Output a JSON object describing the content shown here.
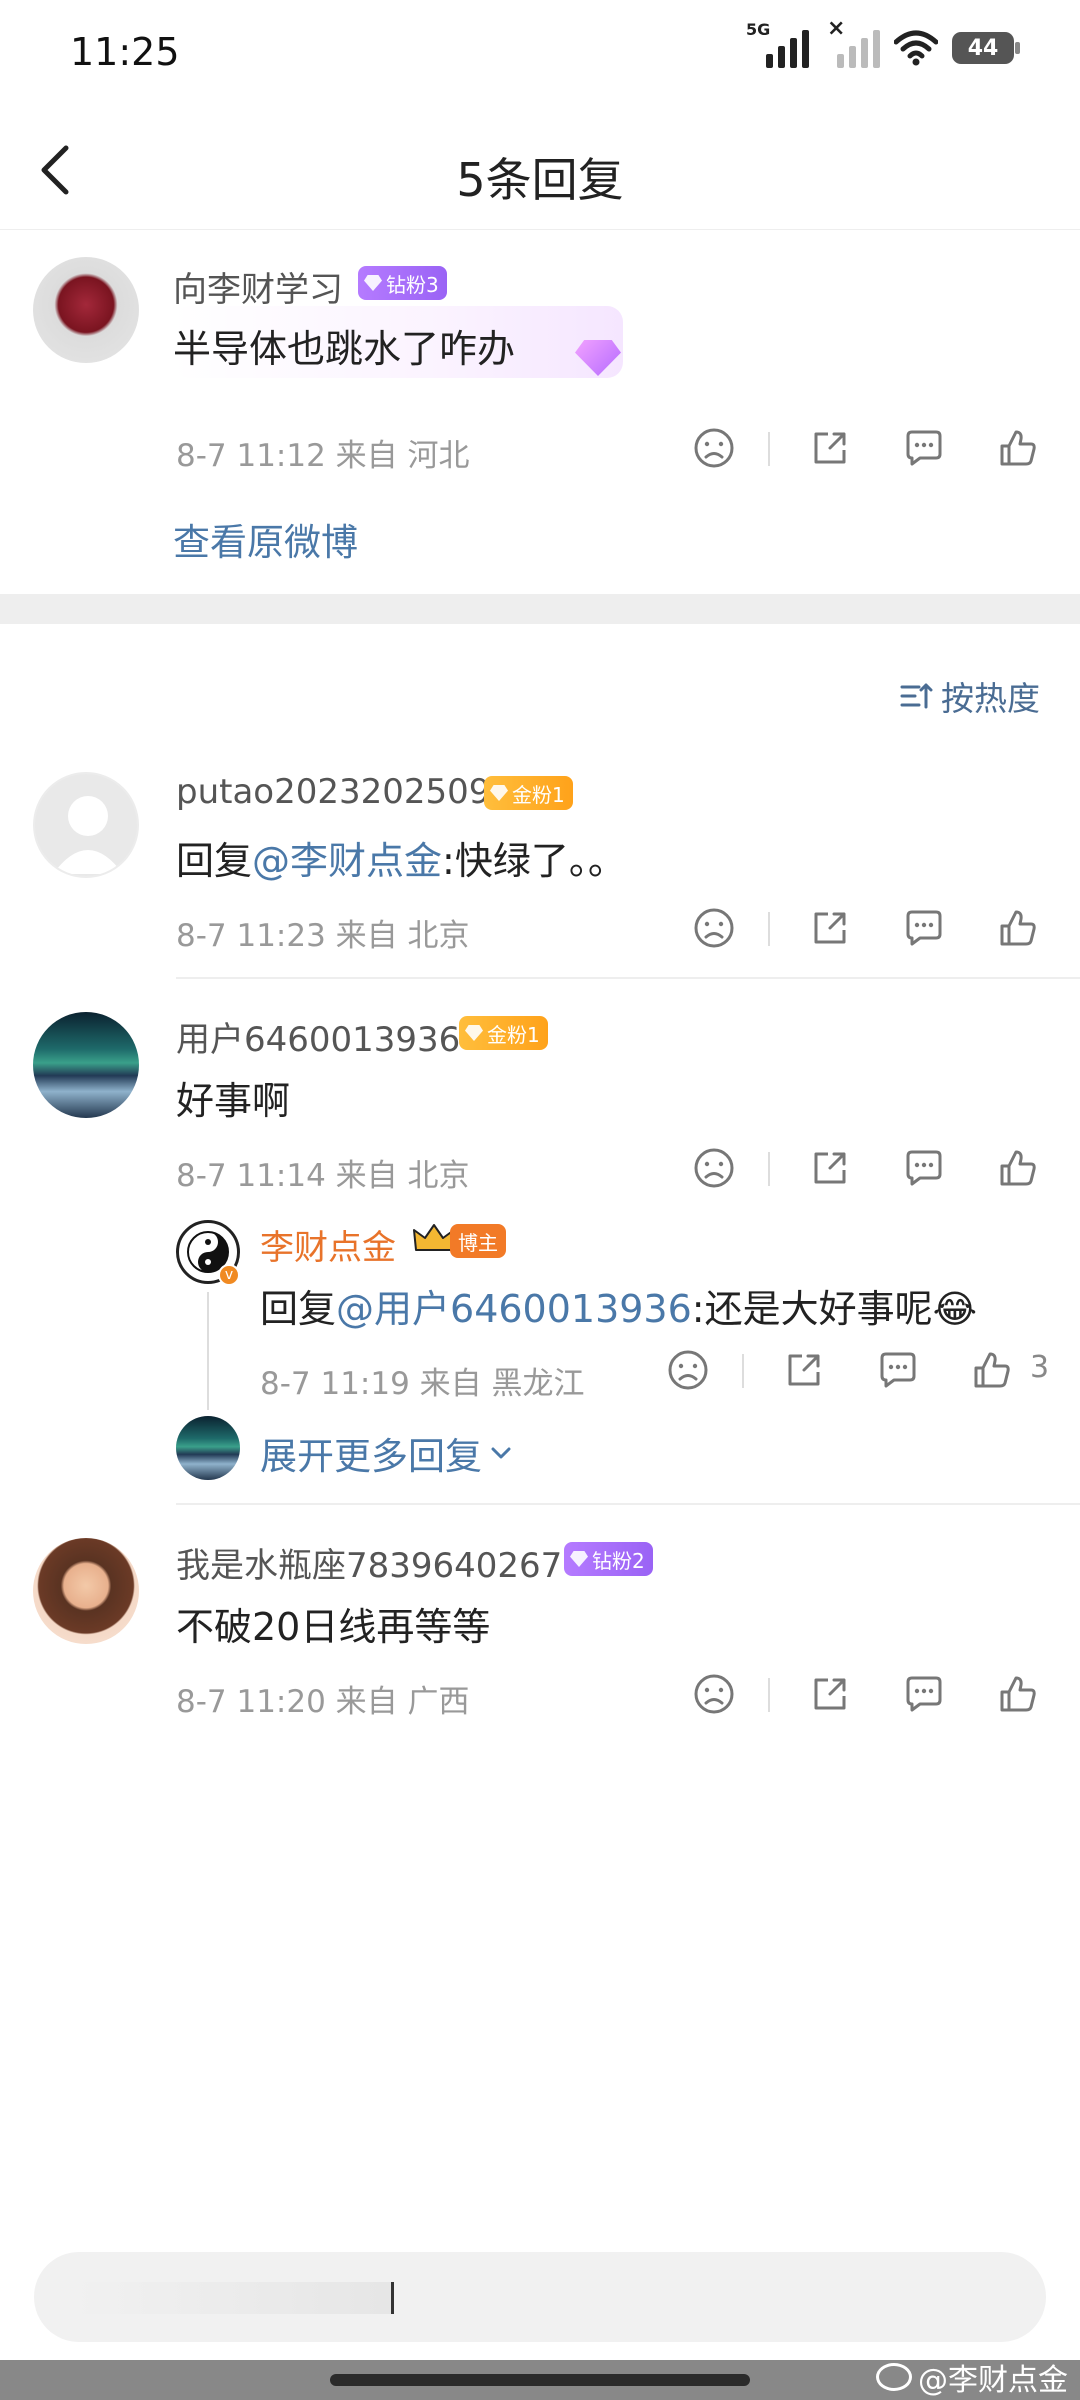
{
  "status": {
    "time": "11:25",
    "network": "5G",
    "battery": "44"
  },
  "nav": {
    "title": "5条回复"
  },
  "original": {
    "username": "向李财学习",
    "badge": "钻粉3",
    "content": "半导体也跳水了咋办",
    "meta": "8-7 11:12  来自 河北",
    "view_original": "查看原微博"
  },
  "sort_label": "按热度",
  "comments": [
    {
      "username": "putao2023202509",
      "badge": "金粉1",
      "reply_prefix": "回复",
      "mention": "@李财点金",
      "content": ":快绿了。。",
      "meta": "8-7 11:23  来自 北京"
    },
    {
      "username": "用户6460013936",
      "badge": "金粉1",
      "content": "好事啊",
      "meta": "8-7 11:14  来自 北京",
      "sub_reply": {
        "username": "李财点金",
        "badge": "博主",
        "reply_prefix": "回复",
        "mention": "@用户6460013936",
        "content": ":还是大好事呢😂",
        "meta": "8-7 11:19  来自 黑龙江",
        "like_count": "3"
      },
      "expand_more": "展开更多回复"
    },
    {
      "username": "我是水瓶座7839640267",
      "badge": "钻粉2",
      "content": "不破20日线再等等",
      "meta": "8-7 11:20  来自 广西"
    }
  ],
  "watermark": "@李财点金",
  "colors": {
    "link": "#4a78a8",
    "blogger": "#e8732a",
    "diamond_badge": "#a86cf7",
    "gold_badge": "#ffb02e"
  }
}
